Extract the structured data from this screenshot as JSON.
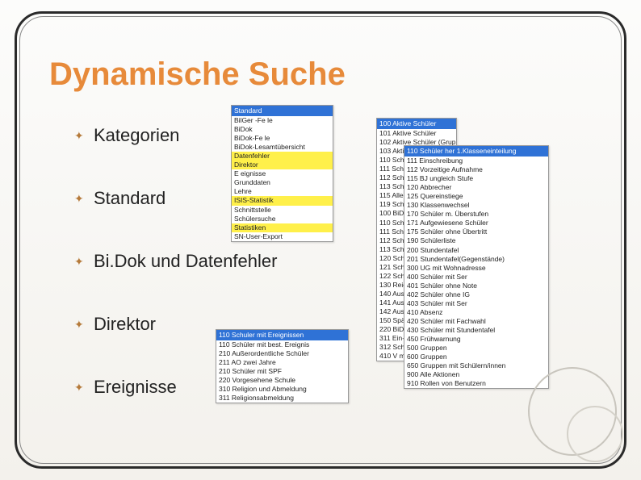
{
  "title": "Dynamische Suche",
  "bullets": [
    "Kategorien",
    "Standard",
    "Bi.Dok und Datenfehler",
    "Direktor",
    "Ereignisse"
  ],
  "panel1": {
    "header": "Standard",
    "items": [
      {
        "t": "BilGer -Fe le",
        "hl": false
      },
      {
        "t": "BiDok",
        "hl": false
      },
      {
        "t": "BiDok-Fe le",
        "hl": false
      },
      {
        "t": "BiDok-Lesamtübersicht",
        "hl": false
      },
      {
        "t": "Datenfehler",
        "hl": true
      },
      {
        "t": "Direktor",
        "hl": true
      },
      {
        "t": "E eignisse",
        "hl": false
      },
      {
        "t": "Grunddaten",
        "hl": false
      },
      {
        "t": "Lehre",
        "hl": false
      },
      {
        "t": "ISIS-Statistik",
        "hl": true
      },
      {
        "t": "Schnittstelle",
        "hl": false
      },
      {
        "t": "Schülersuche",
        "hl": false
      },
      {
        "t": "Statistiken",
        "hl": true
      },
      {
        "t": "SN-User-Export",
        "hl": false
      }
    ]
  },
  "panel2": {
    "header": "100 Aktive Schüler",
    "items": [
      "101 Aktive Schüler",
      "102 Aktive Schüler (Gruppe)",
      "103 Aktive Schüler",
      "110 Schüler (akt)",
      "111 Schüler (E)",
      "112 Schüler (alle)",
      "113 Schüler (2)",
      "115 Alle Schüler",
      "119 Schüler (abg)",
      "100 BiDok-St",
      "110 Schüler",
      "111 Schüler",
      "112 Schüler",
      "113 Schüler",
      "120 Schüler",
      "121 Schüler",
      "122 Schüler",
      "130 Reievan",
      "140 Ausbild.",
      "141 Ausbild.",
      "142 Ausbild.",
      "150 Spätein",
      "220 BiDok-Sch",
      "311 Ein- und Au",
      "312 Schöne",
      "410 V mit LZ"
    ]
  },
  "panel3": {
    "header": "110 Schüler her 1.Klasseneinteilung",
    "items": [
      "111 Einschreibung",
      "112 Vorzeitige Aufnahme",
      "115 BJ ungleich Stufe",
      "120 Abbrecher",
      "125 Quereinstiege",
      "130 Klassenwechsel",
      "170 Schüler m. Überstufen",
      "171 Aufgewiesene Schüler",
      "175 Schüler ohne Übertritt",
      "190 Schülerliste",
      "200 Stundentafel",
      "201 Stundentafel(Gegenstände)",
      "300 UG mit Wohnadresse",
      "400 Schüler mit Ser",
      "401 Schüler ohne Note",
      "402 Schüler ohne IG",
      "403 Schüler mit Ser",
      "410 Absenz",
      "420 Schüler mit Fachwahl",
      "430 Schüler mit Stundentafel",
      "450 Frühwarnung",
      "500 Gruppen",
      "600 Gruppen",
      "650 Gruppen mit Schülern/innen",
      "900 Alle Aktionen",
      "910 Rollen von Benutzern"
    ]
  },
  "panel4": {
    "header": "110 Schuler mit Ereignissen",
    "items": [
      "110 Schüler mit best. Ereignis",
      "210 Außerordentliche Schüler",
      "211 AO zwei Jahre",
      "210 Schüler mit SPF",
      "220 Vorgesehene Schule",
      "310 Religion und Abmeldung",
      "311 Religionsabmeldung"
    ]
  }
}
